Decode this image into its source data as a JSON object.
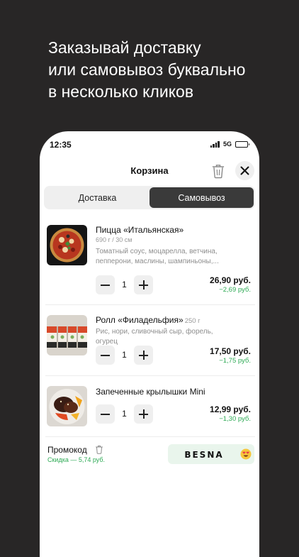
{
  "headline": "Заказывай доставку\nили самовывоз буквально\nв несколько кликов",
  "status_bar": {
    "time": "12:35",
    "network": "5G",
    "battery_level": 1.0
  },
  "header": {
    "title": "Корзина"
  },
  "tabs": [
    {
      "label": "Доставка",
      "active": false
    },
    {
      "label": "Самовывоз",
      "active": true
    }
  ],
  "items": [
    {
      "name": "Пицца «Итальянская»",
      "weight": "690 г / 30 см",
      "description": "Томатный соус, моцарелла, ветчина, пепперони, маслины, шампиньоны,...",
      "quantity": "1",
      "price": "26,90 руб.",
      "discount": "−2,69 руб."
    },
    {
      "name": "Ролл «Филадельфия»",
      "weight": "250 г",
      "description": "Рис, нори, сливочный сыр, форель, огурец",
      "quantity": "1",
      "price": "17,50 руб.",
      "discount": "−1,75 руб."
    },
    {
      "name": "Запеченные крылышки Mini",
      "weight": "",
      "description": "",
      "quantity": "1",
      "price": "12,99 руб.",
      "discount": "−1,30 руб."
    }
  ],
  "promo": {
    "label": "Промокод",
    "saving": "Скидка — 5,74 руб.",
    "code": "BESNA"
  },
  "colors": {
    "background": "#282626",
    "accent_green": "#2eaa55",
    "active_tab": "#3a3a3a",
    "promo_bg": "#e9f5ec"
  }
}
